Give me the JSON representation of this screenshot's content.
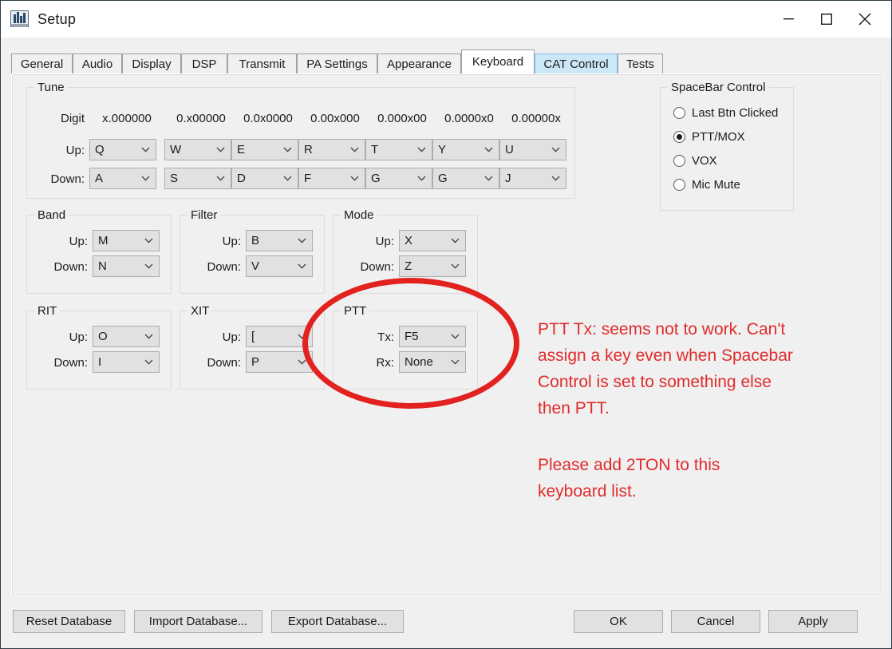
{
  "window": {
    "title": "Setup",
    "icon": "spectrum-window-icon",
    "minimize_glyph": "minimize-icon",
    "maximize_glyph": "maximize-icon",
    "close_glyph": "close-icon"
  },
  "tabs": [
    {
      "label": "General",
      "state": "normal"
    },
    {
      "label": "Audio",
      "state": "normal"
    },
    {
      "label": "Display",
      "state": "normal"
    },
    {
      "label": "DSP",
      "state": "normal"
    },
    {
      "label": "Transmit",
      "state": "normal"
    },
    {
      "label": "PA Settings",
      "state": "normal"
    },
    {
      "label": "Appearance",
      "state": "normal"
    },
    {
      "label": "Keyboard",
      "state": "selected"
    },
    {
      "label": "CAT Control",
      "state": "hovered"
    },
    {
      "label": "Tests",
      "state": "normal"
    }
  ],
  "tune": {
    "legend": "Tune",
    "digit_label": "Digit",
    "digit_headers": [
      "x.000000",
      "0.x00000",
      "0.0x0000",
      "0.00x000",
      "0.000x00",
      "0.0000x0",
      "0.00000x"
    ],
    "up_label": "Up:",
    "down_label": "Down:",
    "up_values": [
      "Q",
      "W",
      "E",
      "R",
      "T",
      "Y",
      "U"
    ],
    "down_values": [
      "A",
      "S",
      "D",
      "F",
      "G",
      "G",
      "J"
    ]
  },
  "band": {
    "legend": "Band",
    "up_label": "Up:",
    "down_label": "Down:",
    "up": "M",
    "down": "N"
  },
  "filter": {
    "legend": "Filter",
    "up_label": "Up:",
    "down_label": "Down:",
    "up": "B",
    "down": "V"
  },
  "mode": {
    "legend": "Mode",
    "up_label": "Up:",
    "down_label": "Down:",
    "up": "X",
    "down": "Z"
  },
  "rit": {
    "legend": "RIT",
    "up_label": "Up:",
    "down_label": "Down:",
    "up": "O",
    "down": "I"
  },
  "xit": {
    "legend": "XIT",
    "up_label": "Up:",
    "down_label": "Down:",
    "up": "[",
    "down": "P"
  },
  "ptt": {
    "legend": "PTT",
    "tx_label": "Tx:",
    "rx_label": "Rx:",
    "tx": "F5",
    "rx": "None"
  },
  "spacebar": {
    "legend": "SpaceBar Control",
    "options": [
      {
        "label": "Last Btn Clicked",
        "selected": false
      },
      {
        "label": "PTT/MOX",
        "selected": true
      },
      {
        "label": "VOX",
        "selected": false
      },
      {
        "label": "Mic Mute",
        "selected": false
      }
    ]
  },
  "annotations": {
    "color": "#e02b2b",
    "note1": "PTT Tx: seems not to work. Can't\nassign a key even when Spacebar\nControl is set to something else\nthen PTT.",
    "note2": "Please add 2TON to this\nkeyboard list."
  },
  "footer": {
    "reset": "Reset Database",
    "import": "Import Database...",
    "export": "Export Database...",
    "ok": "OK",
    "cancel": "Cancel",
    "apply": "Apply"
  }
}
